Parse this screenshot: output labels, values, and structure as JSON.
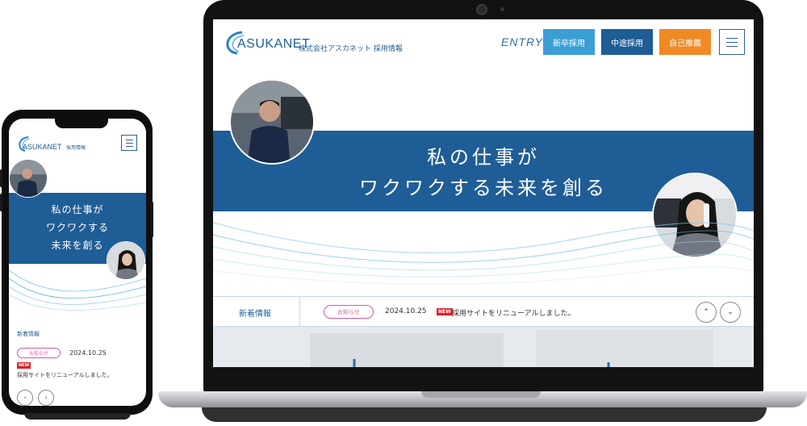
{
  "brand": {
    "logo_text": "ASUKANET",
    "company_subtitle": "株式会社アスカネット 採用情報",
    "mobile_subtitle": "採用情報",
    "colors": {
      "primary": "#1f5d96",
      "light_blue": "#3b9fd4",
      "orange": "#ef8a24",
      "pink": "#d15aa4",
      "new_red": "#d8232a"
    }
  },
  "header": {
    "entry_label": "ENTRY",
    "buttons": [
      {
        "label": "新卒採用"
      },
      {
        "label": "中途採用"
      },
      {
        "label": "自己推薦"
      }
    ],
    "menu_icon": "hamburger-icon"
  },
  "hero": {
    "line1": "私の仕事が",
    "line2": "ワクワクする未来を創る",
    "mobile_line1": "私の仕事が",
    "mobile_line2": "ワクワクする",
    "mobile_line3": "未来を創る"
  },
  "news": {
    "title": "新着情報",
    "category": "お知らせ",
    "date": "2024.10.25",
    "new_badge": "NEW",
    "headline": "採用サイトをリニューアルしました。",
    "up_icon": "chevron-up-icon",
    "down_icon": "chevron-down-icon"
  },
  "bottom": {
    "sign_text": "ASUKANET"
  }
}
